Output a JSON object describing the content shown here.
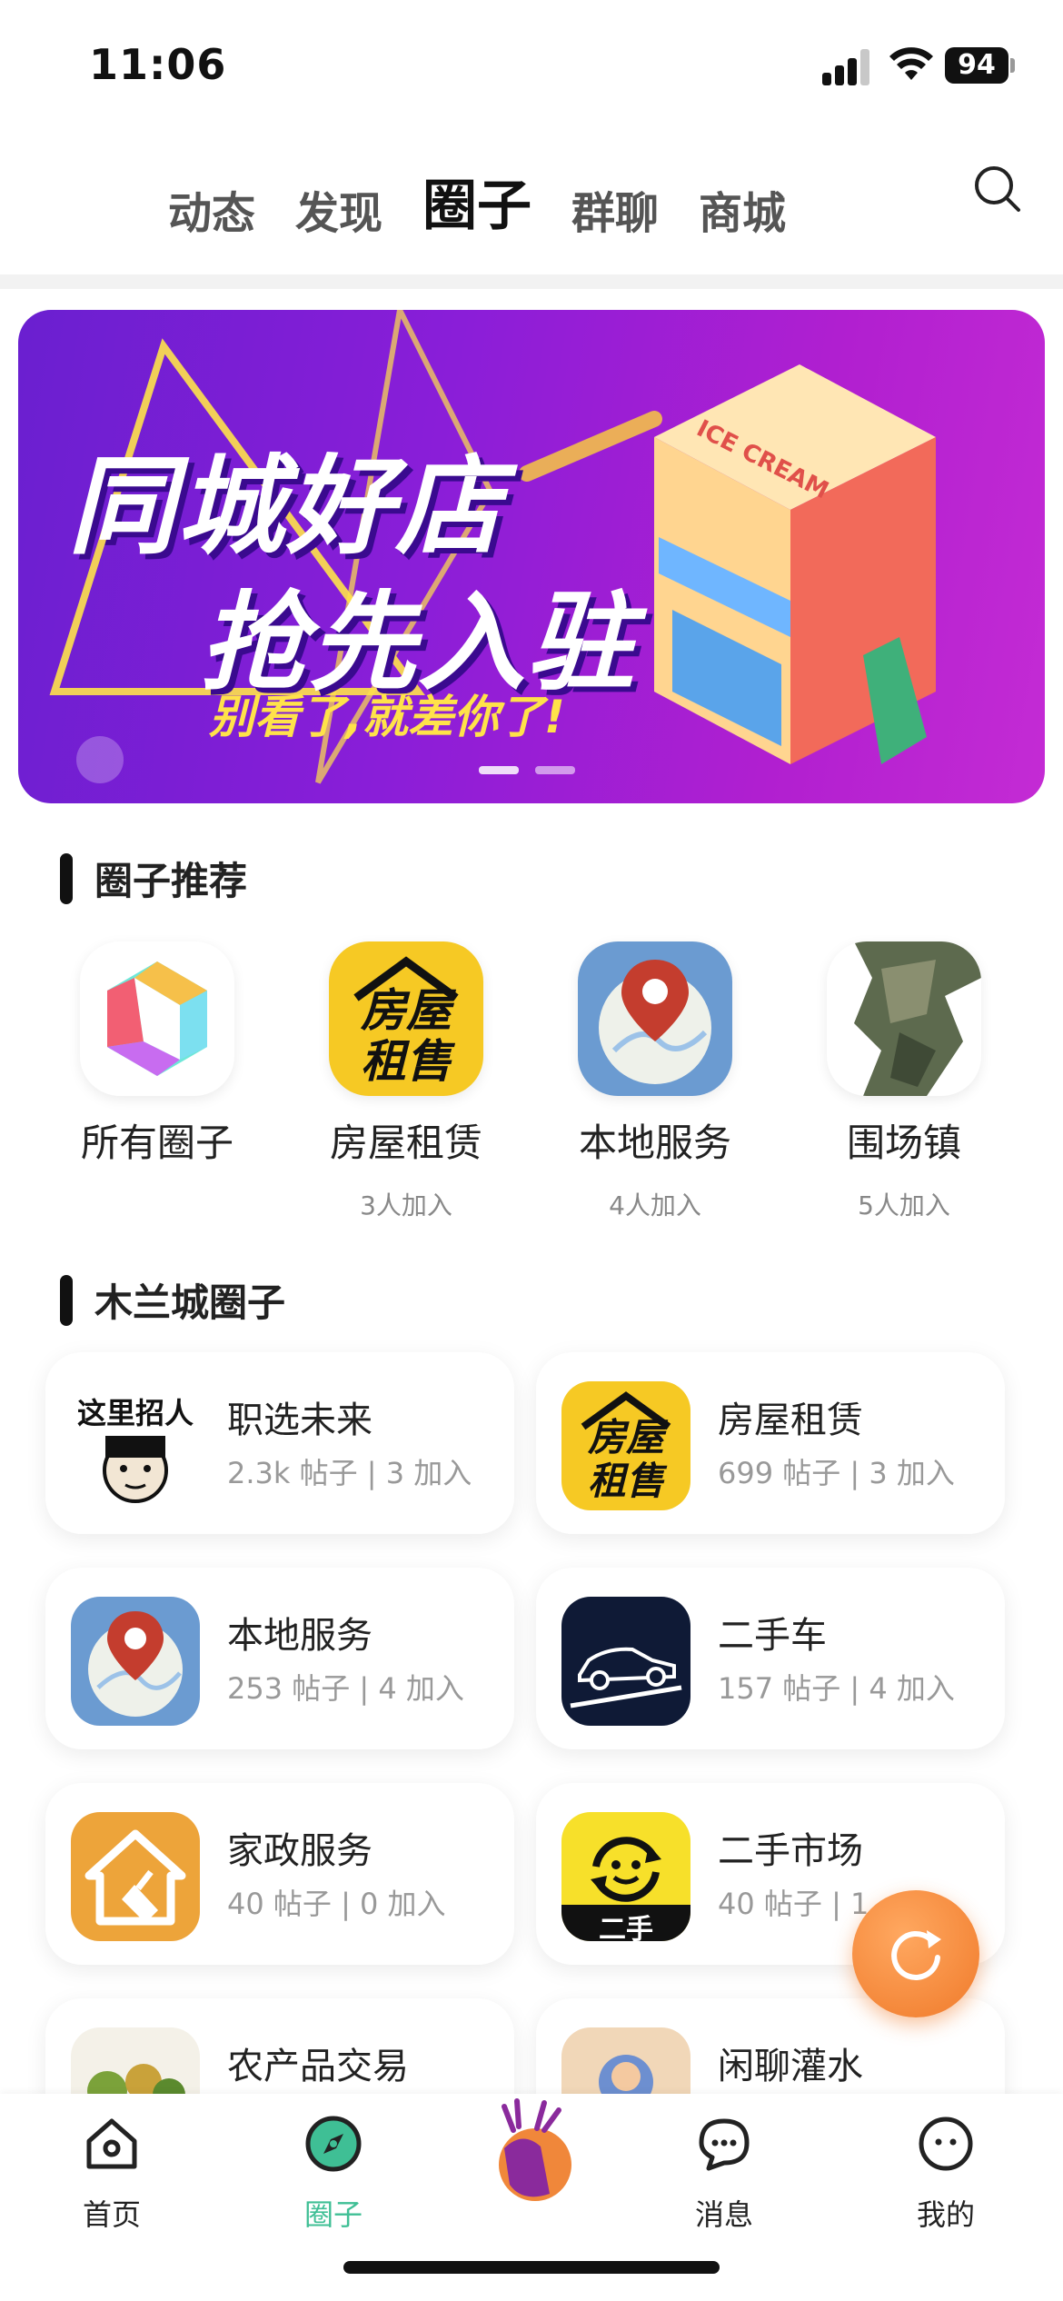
{
  "status": {
    "time": "11:06",
    "battery": "94"
  },
  "top_tabs": [
    {
      "label": "动态"
    },
    {
      "label": "发现"
    },
    {
      "label": "圈子"
    },
    {
      "label": "群聊"
    },
    {
      "label": "商城"
    }
  ],
  "banner": {
    "line1": "同城好店",
    "line2": "抢先入驻",
    "subtitle": "别看了,就差你了!",
    "sign_text": "ICE CREAM"
  },
  "recommend": {
    "title": "圈子推荐",
    "items": [
      {
        "name": "所有圈子",
        "count": ""
      },
      {
        "name": "房屋租赁",
        "count": "3人加入",
        "icon_text_1": "房屋",
        "icon_text_2": "租售"
      },
      {
        "name": "本地服务",
        "count": "4人加入"
      },
      {
        "name": "围场镇",
        "count": "5人加入"
      }
    ]
  },
  "city_section": {
    "title": "木兰城圈子",
    "cards": [
      {
        "title": "职选未来",
        "meta": "2.3k 帖子 |  3 加入",
        "icon_text": "这里招人"
      },
      {
        "title": "房屋租赁",
        "meta": "699 帖子 |  3 加入",
        "icon_text_1": "房屋",
        "icon_text_2": "租售"
      },
      {
        "title": "本地服务",
        "meta": "253 帖子 |  4 加入"
      },
      {
        "title": "二手车",
        "meta": "157 帖子 |  4 加入"
      },
      {
        "title": "家政服务",
        "meta": "40 帖子 |  0 加入"
      },
      {
        "title": "二手市场",
        "meta": "40 帖子 |  1",
        "icon_text": "二手"
      },
      {
        "title": "农产品交易",
        "meta": ""
      },
      {
        "title": "闲聊灌水",
        "meta": ""
      }
    ]
  },
  "tabbar": [
    {
      "label": "首页",
      "icon": "home-icon"
    },
    {
      "label": "圈子",
      "icon": "compass-icon",
      "active": true
    },
    {
      "label": "",
      "icon": "deer-logo-icon"
    },
    {
      "label": "消息",
      "icon": "chat-icon"
    },
    {
      "label": "我的",
      "icon": "profile-icon"
    }
  ],
  "colors": {
    "accent": "#3fbf95",
    "fab": "#f07a2a",
    "banner": "#8a1ed8"
  }
}
